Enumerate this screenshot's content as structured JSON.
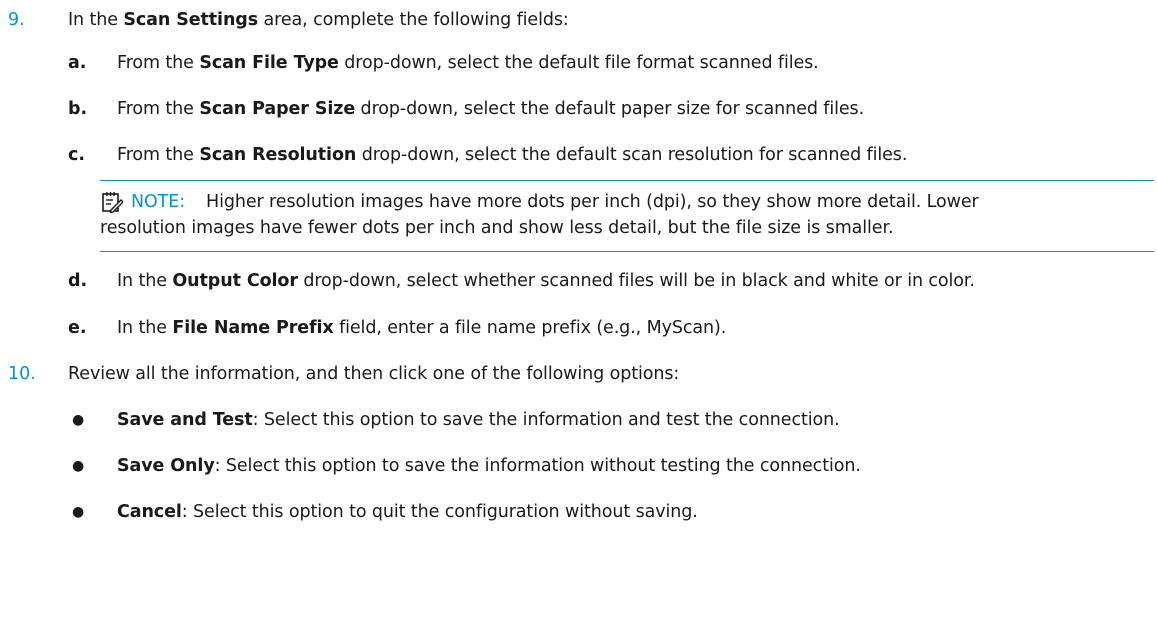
{
  "step9": {
    "number": "9.",
    "pre": "In the ",
    "bold": "Scan Settings",
    "post": " area, complete the following fields:"
  },
  "substeps": [
    {
      "letter": "a.",
      "pre": "From the ",
      "bold": "Scan File Type",
      "post": " drop-down, select the default file format scanned files."
    },
    {
      "letter": "b.",
      "pre": "From the ",
      "bold": "Scan Paper Size",
      "post": " drop-down, select the default paper size for scanned files."
    },
    {
      "letter": "c.",
      "pre": "From the ",
      "bold": "Scan Resolution",
      "post": " drop-down, select the default scan resolution for scanned files."
    },
    {
      "letter": "d.",
      "pre": "In the ",
      "bold": "Output Color",
      "post": " drop-down, select whether scanned files will be in black and white or in color."
    },
    {
      "letter": "e.",
      "pre": "In the ",
      "bold": "File Name Prefix",
      "post": " field, enter a file name prefix (e.g., MyScan)."
    }
  ],
  "note": {
    "icon": "note-icon",
    "label": "NOTE:",
    "line1": "Higher resolution images have more dots per inch (dpi), so they show more detail. Lower",
    "line2": "resolution images have fewer dots per inch and show less detail, but the file size is smaller."
  },
  "step10": {
    "number": "10.",
    "text": "Review all the information, and then click one of the following options:"
  },
  "options": [
    {
      "bullet": "●",
      "bold": "Save and Test",
      "text": ": Select this option to save the information and test the connection."
    },
    {
      "bullet": "●",
      "bold": "Save Only",
      "text": ": Select this option to save the information without testing the connection."
    },
    {
      "bullet": "●",
      "bold": "Cancel",
      "text": ": Select this option to quit the configuration without saving."
    }
  ],
  "colors": {
    "accent": "#0096d6",
    "text": "#1a1a1a"
  }
}
